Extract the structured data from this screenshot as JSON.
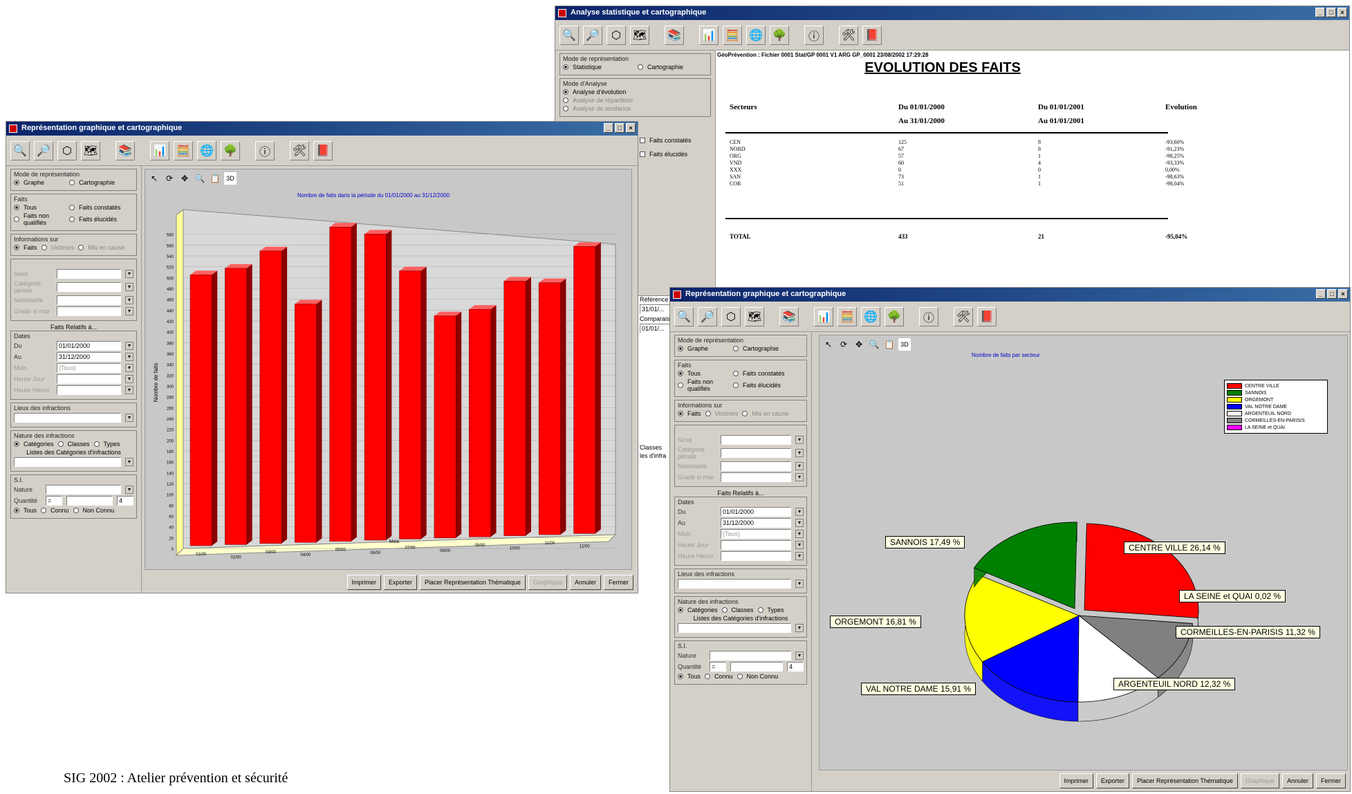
{
  "win_stats": {
    "title": "Analyse statistique et cartographique",
    "mode_label": "Mode de représentation",
    "mode_opts": [
      "Statistique",
      "Cartographie"
    ],
    "analyse_label": "Mode d'Analyse",
    "analyse_opts": [
      "Analyse d'évolution",
      "Analyse de répartition",
      "Analyse de tendance"
    ],
    "report": {
      "header": "GéoPrévention : Fichier 0001 Stat/GP 0001 V1 ARG GP_0001 23/08/2002 17:29:28",
      "title": "EVOLUTION DES FAITS",
      "col_headers": [
        "Secteurs",
        "Du 01/01/2000",
        "Du 01/01/2001",
        "Evolution"
      ],
      "col_sub": [
        "",
        "Au 31/01/2000",
        "Au 01/01/2001",
        ""
      ],
      "rows": [
        [
          "CEN",
          "125",
          "8",
          "-93,60%"
        ],
        [
          "NORD",
          "67",
          "8",
          "-91,23%"
        ],
        [
          "ORG",
          "57",
          "1",
          "-98,25%"
        ],
        [
          "VND",
          "60",
          "4",
          "-93,33%"
        ],
        [
          "XXX",
          "0",
          "0",
          "0,00%"
        ],
        [
          "SAN",
          "73",
          "1",
          "-98,63%"
        ],
        [
          "COR",
          "51",
          "1",
          "-98,04%"
        ]
      ],
      "total": [
        "TOTAL",
        "433",
        "21",
        "-95,04%"
      ]
    },
    "side_opts": [
      "Faits constatés",
      "Faits élucidés"
    ],
    "side_labels": [
      "Référence",
      "Comparaison"
    ],
    "side_dates": [
      "31/01/...",
      "01/01/..."
    ],
    "side_extra": [
      "Classes",
      "les d'infra"
    ]
  },
  "win_bar": {
    "title": "Représentation graphique et cartographique",
    "mode_label": "Mode de représentation",
    "mode_opts": [
      "Graphe",
      "Cartographie"
    ],
    "faits_label": "Faits",
    "faits_opts": [
      "Tous",
      "Faits constatés",
      "Faits non qualifiés",
      "Faits élucidés"
    ],
    "info_label": "Informations sur",
    "info_opts": [
      "Faits",
      "Victimes",
      "Mis en cause"
    ],
    "fields": [
      "Sexe",
      "Catégorie pénale",
      "Nationalité",
      "Grade si mar"
    ],
    "rel_label": "Faits Relatifs à...",
    "dates_label": "Dates",
    "du_label": "Du",
    "du_val": "01/01/2000",
    "au_label": "Au",
    "au_val": "31/12/2000",
    "more_fields": [
      "Mois",
      "Heure Jour",
      "Heure Heure"
    ],
    "mois_val": "(Tous)",
    "lieu_label": "Lieux des infractions",
    "nature_label": "Nature des infractions",
    "nature_opts": [
      "Catégories",
      "Classes",
      "Types"
    ],
    "liste_label": "Listes des Catégories d'infractions",
    "sig_label": "S.I.",
    "nature2": "Nature",
    "quantite": "Quantité",
    "quant_a": "=",
    "quant_b": "4",
    "quant_opts": [
      "Tous",
      "Connu",
      "Non Connu"
    ],
    "buttons": [
      "Imprimer",
      "Exporter",
      "Placer Représentation Thématique",
      "Graphique",
      "Annuler",
      "Fermer"
    ],
    "chart_title": "Nombre de faits dans la période du 01/01/2000 au 31/12/2000",
    "ylabel": "Nombre de faits",
    "xlabel": "Mois"
  },
  "win_pie": {
    "title": "Représentation graphique et cartographique",
    "chart_title": "Nombre de faits par secteur",
    "du_val": "01/01/2000",
    "au_val": "31/12/2000"
  },
  "footer": "SIG 2002 : Atelier prévention et sécurité",
  "chart_data": [
    {
      "type": "bar",
      "title": "Nombre de faits dans la période du 01/01/2000 au 31/12/2000",
      "ylabel": "Nombre de faits",
      "xlabel": "Mois",
      "categories": [
        "01/00",
        "02/00",
        "03/00",
        "04/00",
        "05/00",
        "06/00",
        "07/00",
        "08/00",
        "09/00",
        "10/00",
        "11/00",
        "12/00"
      ],
      "values": [
        500,
        510,
        540,
        440,
        580,
        565,
        495,
        410,
        420,
        470,
        465,
        530
      ],
      "ylim": [
        0,
        600
      ],
      "yticks": [
        0,
        20,
        40,
        60,
        80,
        100,
        120,
        140,
        160,
        180,
        200,
        220,
        240,
        260,
        280,
        300,
        320,
        340,
        360,
        380,
        400,
        420,
        440,
        460,
        480,
        500,
        520,
        540,
        560,
        580
      ],
      "color": "#ff0000"
    },
    {
      "type": "pie",
      "title": "Nombre de faits par secteur",
      "slices": [
        {
          "name": "CENTRE VILLE",
          "label": "CENTRE VILLE 26,14 %",
          "value": 26.14,
          "color": "#ff0000"
        },
        {
          "name": "LA SEINE et QUAI",
          "label": "LA SEINE et QUAI 0,02 %",
          "value": 0.02,
          "color": "#ff00ff"
        },
        {
          "name": "CORMEILLES-EN-PARISIS",
          "label": "CORMEILLES-EN-PARISIS 11,32 %",
          "value": 11.32,
          "color": "#808080"
        },
        {
          "name": "ARGENTEUIL NORD",
          "label": "ARGENTEUIL NORD 12,32 %",
          "value": 12.32,
          "color": "#ffffff"
        },
        {
          "name": "VAL NOTRE DAME",
          "label": "VAL NOTRE DAME 15,91 %",
          "value": 15.91,
          "color": "#0000ff"
        },
        {
          "name": "ORGEMONT",
          "label": "ORGEMONT 16,81 %",
          "value": 16.81,
          "color": "#ffff00"
        },
        {
          "name": "SANNOIS",
          "label": "SANNOIS 17,49 %",
          "value": 17.49,
          "color": "#008000"
        }
      ],
      "legend": [
        "CENTRE VILLE",
        "SANNOIS",
        "ORGEMONT",
        "VAL NOTRE DAME",
        "ARGENTEUIL NORD",
        "CORMEILLES-EN-PARISIS",
        "LA SEINE et QUAI"
      ]
    }
  ]
}
